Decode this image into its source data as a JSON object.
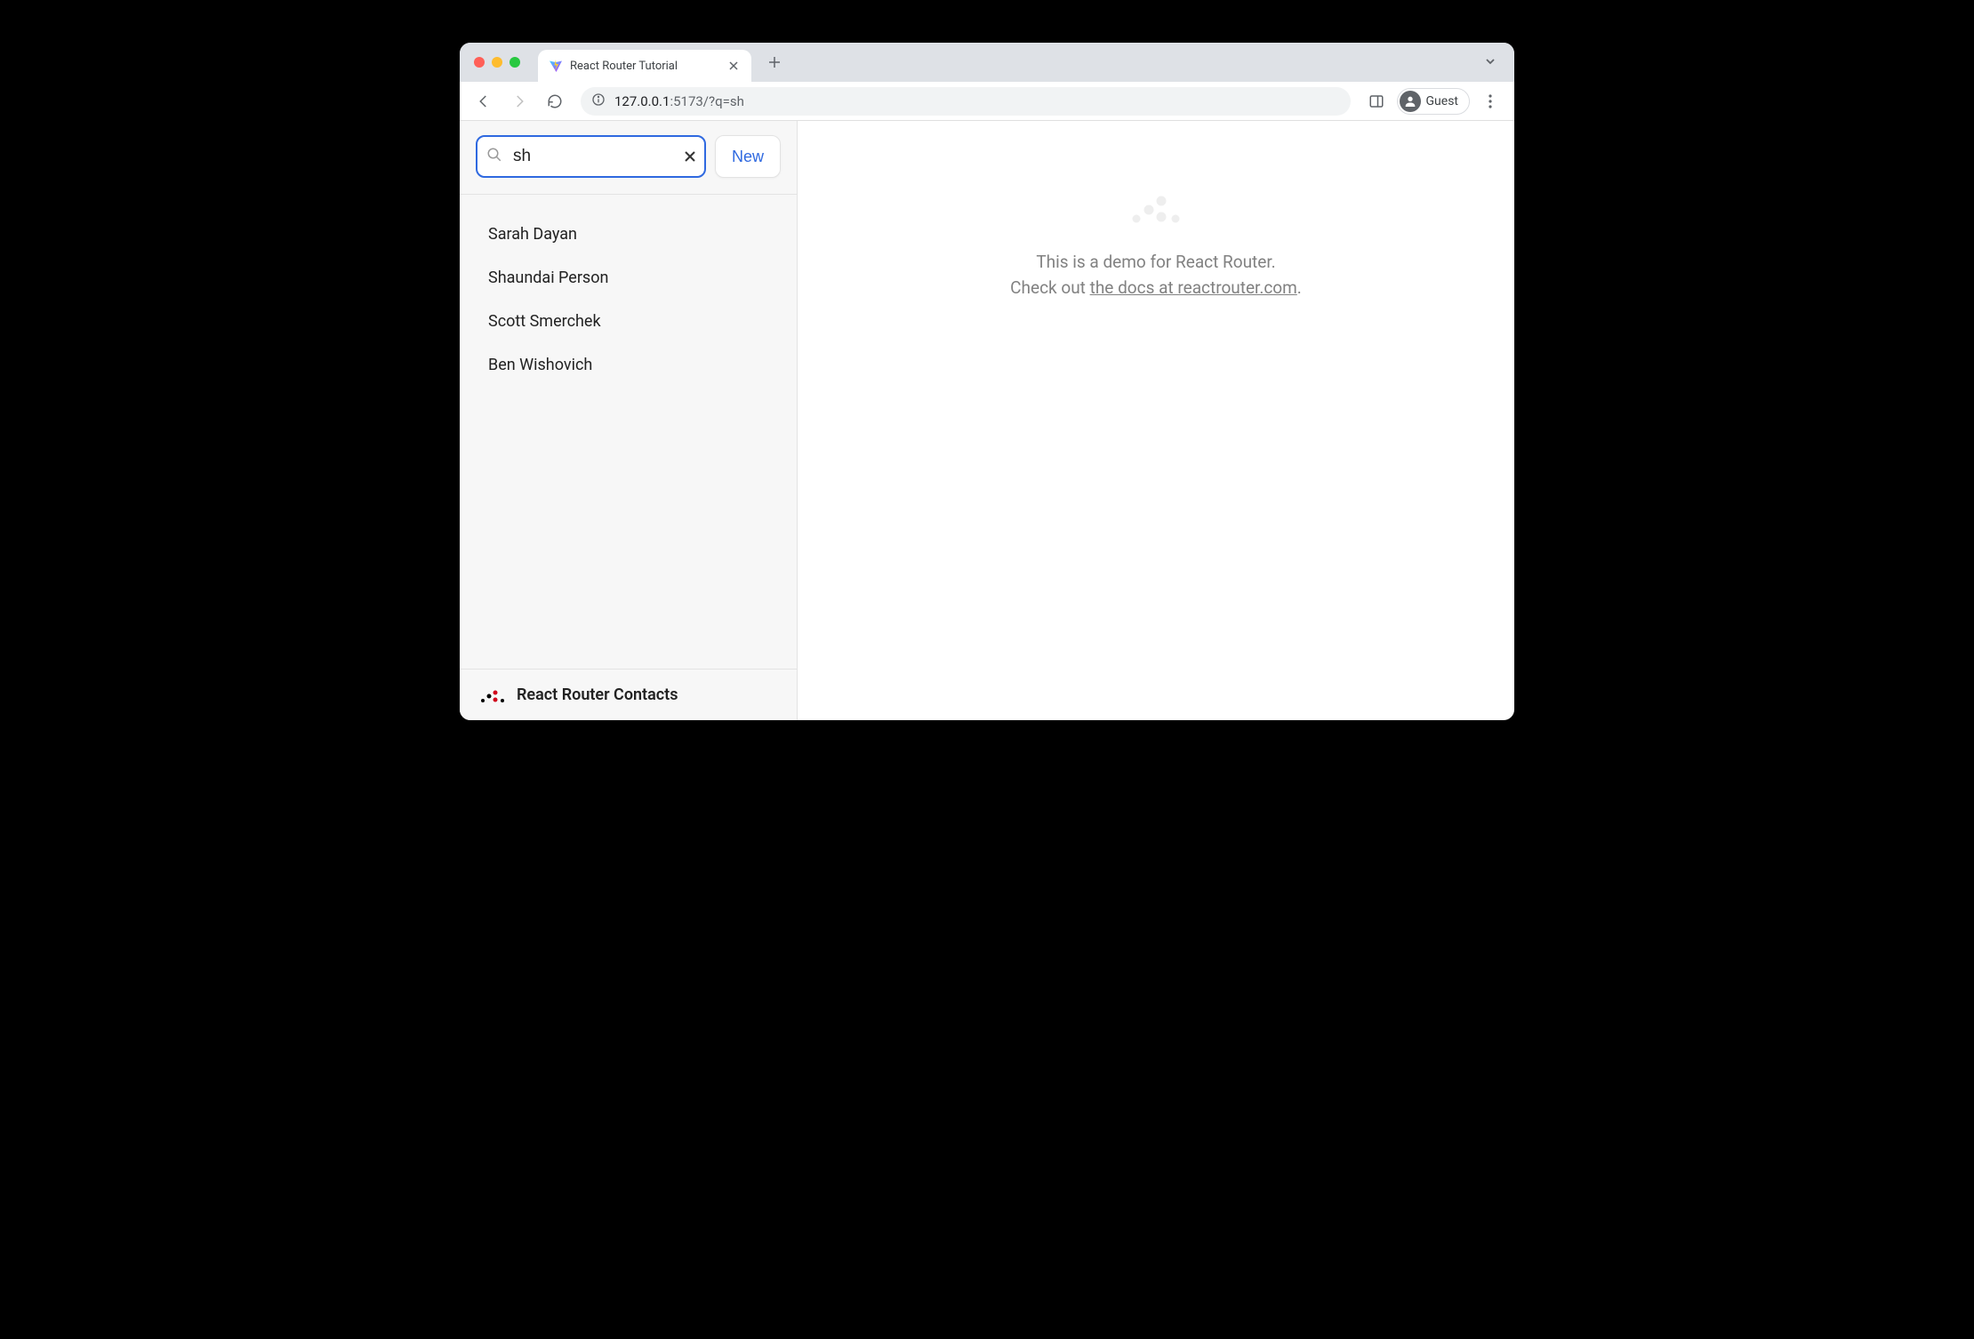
{
  "browser": {
    "tab_title": "React Router Tutorial",
    "url_host": "127.0.0.1",
    "url_path": ":5173/?q=sh",
    "profile_label": "Guest"
  },
  "sidebar": {
    "search_value": "sh",
    "new_button": "New",
    "contacts": [
      "Sarah Dayan",
      "Shaundai Person",
      "Scott Smerchek",
      "Ben Wishovich"
    ],
    "footer_title": "React Router Contacts"
  },
  "detail": {
    "line1": "This is a demo for React Router.",
    "line2_prefix": "Check out ",
    "line2_link": "the docs at reactrouter.com",
    "line2_suffix": "."
  }
}
